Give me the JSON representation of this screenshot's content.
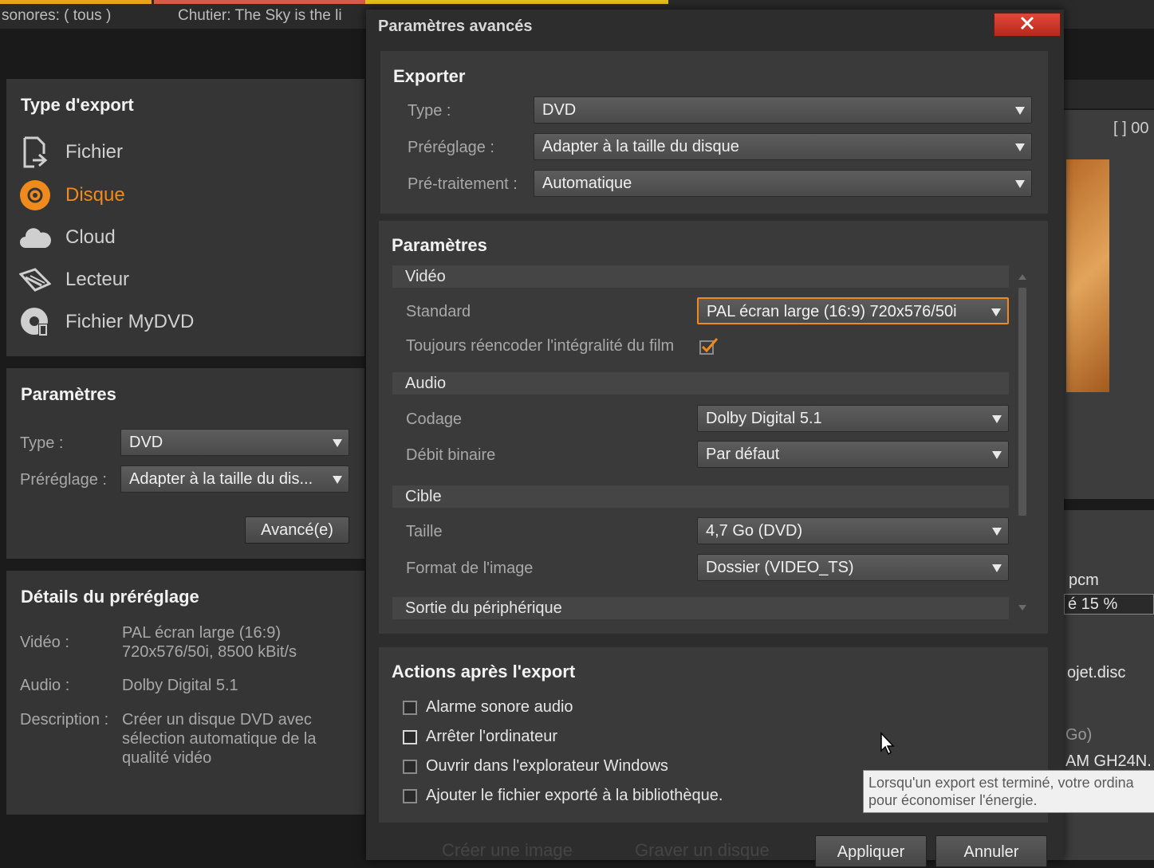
{
  "top_tabs": [
    {
      "label": "sonores: ( tous )"
    },
    {
      "label": "Chutier: The Sky is the li"
    }
  ],
  "export_type": {
    "title": "Type d'export",
    "items": [
      {
        "label": "Fichier",
        "icon": "file-export-icon"
      },
      {
        "label": "Disque",
        "icon": "disc-icon",
        "active": true
      },
      {
        "label": "Cloud",
        "icon": "cloud-icon"
      },
      {
        "label": "Lecteur",
        "icon": "device-icon"
      },
      {
        "label": "Fichier MyDVD",
        "icon": "mydvd-icon"
      }
    ]
  },
  "params": {
    "title": "Paramètres",
    "type_label": "Type :",
    "type_value": "DVD",
    "preset_label": "Préréglage :",
    "preset_value": "Adapter à la taille du dis...",
    "advanced_button": "Avancé(e)"
  },
  "details": {
    "title": "Détails du préréglage",
    "video_label": "Vidéo :",
    "video_line1": "PAL écran large (16:9)",
    "video_line2": "720x576/50i, 8500 kBit/s",
    "audio_label": "Audio :",
    "audio_value": "Dolby Digital 5.1",
    "desc_label": "Description :",
    "desc_line1": "Créer un disque DVD avec",
    "desc_line2": "sélection automatique de la",
    "desc_line3": "qualité vidéo"
  },
  "right_bg": {
    "timecode": "[ ] 00",
    "pcm": "pcm",
    "percent": "é 15 %",
    "projet": "ojet.disc",
    "go": "Go)",
    "cam": "AM GH24N."
  },
  "dialog": {
    "title": "Paramètres avancés",
    "exporter": {
      "title": "Exporter",
      "type_label": "Type :",
      "type_value": "DVD",
      "preset_label": "Préréglage :",
      "preset_value": "Adapter à la taille du disque",
      "pretreat_label": "Pré-traitement :",
      "pretreat_value": "Automatique"
    },
    "parametres": {
      "title": "Paramètres",
      "video_header": "Vidéo",
      "standard_label": "Standard",
      "standard_value": "PAL écran large (16:9) 720x576/50i",
      "reencode_label": "Toujours réencoder l'intégralité du film",
      "audio_header": "Audio",
      "codec_label": "Codage",
      "codec_value": "Dolby Digital 5.1",
      "bitrate_label": "Débit binaire",
      "bitrate_value": "Par défaut",
      "target_header": "Cible",
      "size_label": "Taille",
      "size_value": "4,7 Go (DVD)",
      "format_label": "Format de l'image",
      "format_value": "Dossier (VIDEO_TS)",
      "device_header": "Sortie du périphérique"
    },
    "actions": {
      "title": "Actions après l'export",
      "items": [
        {
          "label": "Alarme sonore audio"
        },
        {
          "label": "Arrêter l'ordinateur"
        },
        {
          "label": "Ouvrir dans l'explorateur Windows"
        },
        {
          "label": "Ajouter le fichier exporté à la bibliothèque."
        }
      ]
    },
    "tooltip_line1": "Lorsqu'un export est terminé, votre ordina",
    "tooltip_line2": "pour économiser l'énergie.",
    "ghost_create": "Créer une image",
    "ghost_burn": "Graver un disque",
    "apply_button": "Appliquer",
    "cancel_button": "Annuler"
  },
  "colors": {
    "accent": "#f08a1c",
    "close_red": "#d83a2c",
    "panel": "#353535"
  }
}
